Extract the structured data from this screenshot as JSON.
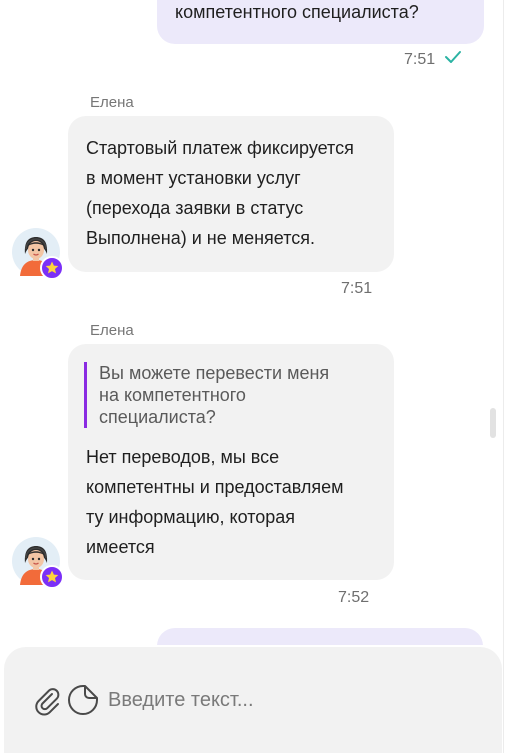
{
  "messages": {
    "out_top": {
      "text": "компетентного специалиста?",
      "time": "7:51",
      "status_icon": "double-check-icon"
    },
    "in_1": {
      "sender": "Елена",
      "lines": [
        "Стартовый платеж фиксируется",
        "в момент установки услуг",
        "(перехода заявки в статус",
        "Выполнена) и не меняется."
      ],
      "time": "7:51"
    },
    "in_2": {
      "sender": "Елена",
      "quote_lines": [
        "Вы можете перевести меня",
        "на компетентного",
        "специалиста?"
      ],
      "lines": [
        "Нет переводов, мы все",
        "компетентны и предоставляем",
        "ту информацию, которая",
        "имеется"
      ],
      "time": "7:52"
    }
  },
  "composer": {
    "placeholder": "Введите текст...",
    "attach_icon": "paperclip-icon",
    "sticker_icon": "sticker-icon"
  },
  "colors": {
    "outgoing_bubble": "#ece9fa",
    "incoming_bubble": "#f2f2f2",
    "accent": "#7b2ff7",
    "check": "#2bb3a3"
  }
}
